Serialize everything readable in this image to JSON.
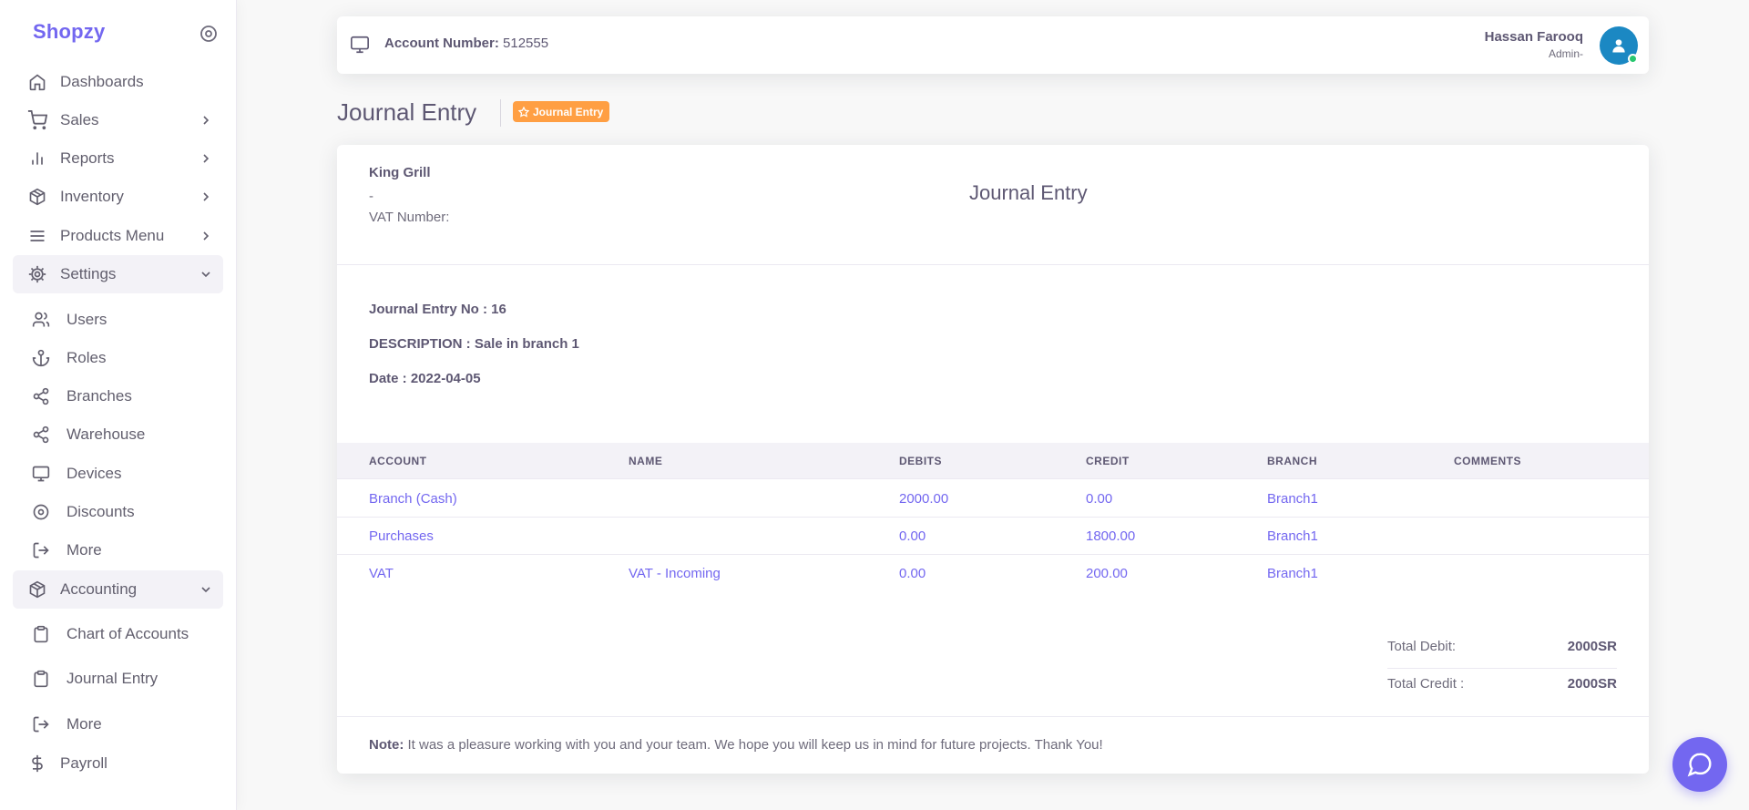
{
  "brand": {
    "name": "Shopzy"
  },
  "sidebar": {
    "items": [
      {
        "label": "Dashboards"
      },
      {
        "label": "Sales"
      },
      {
        "label": "Reports"
      },
      {
        "label": "Inventory"
      },
      {
        "label": "Products Menu"
      },
      {
        "label": "Settings"
      }
    ],
    "settings_sub": [
      {
        "label": "Users"
      },
      {
        "label": "Roles"
      },
      {
        "label": "Branches"
      },
      {
        "label": "Warehouse"
      },
      {
        "label": "Devices"
      },
      {
        "label": "Discounts"
      },
      {
        "label": "More"
      }
    ],
    "accounting": {
      "label": "Accounting"
    },
    "accounting_sub": [
      {
        "label": "Chart of Accounts"
      },
      {
        "label": "Journal Entry"
      },
      {
        "label": "More"
      }
    ],
    "payroll": {
      "label": "Payroll"
    }
  },
  "header": {
    "account_label": "Account Number:",
    "account_number": "512555",
    "user_name": "Hassan Farooq",
    "user_role": "Admin-"
  },
  "page": {
    "title": "Journal Entry",
    "badge": "Journal Entry"
  },
  "card": {
    "company": "King Grill",
    "company_line2": "-",
    "vat_label": "VAT Number:",
    "heading": "Journal Entry",
    "entry_no": "Journal Entry No : 16",
    "description": "DESCRIPTION : Sale in branch 1",
    "date": "Date : 2022-04-05",
    "columns": [
      "ACCOUNT",
      "NAME",
      "DEBITS",
      "CREDIT",
      "BRANCH",
      "COMMENTS"
    ],
    "rows": [
      {
        "account": "Branch (Cash)",
        "name": "",
        "debits": "2000.00",
        "credit": "0.00",
        "branch": "Branch1",
        "comments": ""
      },
      {
        "account": "Purchases",
        "name": "",
        "debits": "0.00",
        "credit": "1800.00",
        "branch": "Branch1",
        "comments": ""
      },
      {
        "account": "VAT",
        "name": "VAT - Incoming",
        "debits": "0.00",
        "credit": "200.00",
        "branch": "Branch1",
        "comments": ""
      }
    ],
    "total_debit_label": "Total Debit:",
    "total_debit": "2000SR",
    "total_credit_label": "Total Credit :",
    "total_credit": "2000SR",
    "note_label": "Note:",
    "note_text": " It was a pleasure working with you and your team. We hope you will keep us in mind for future projects. Thank You!"
  },
  "colors": {
    "primary": "#7367f0",
    "badge": "#ff9f43",
    "online": "#28c76f",
    "avatar": "#1b88c3"
  }
}
